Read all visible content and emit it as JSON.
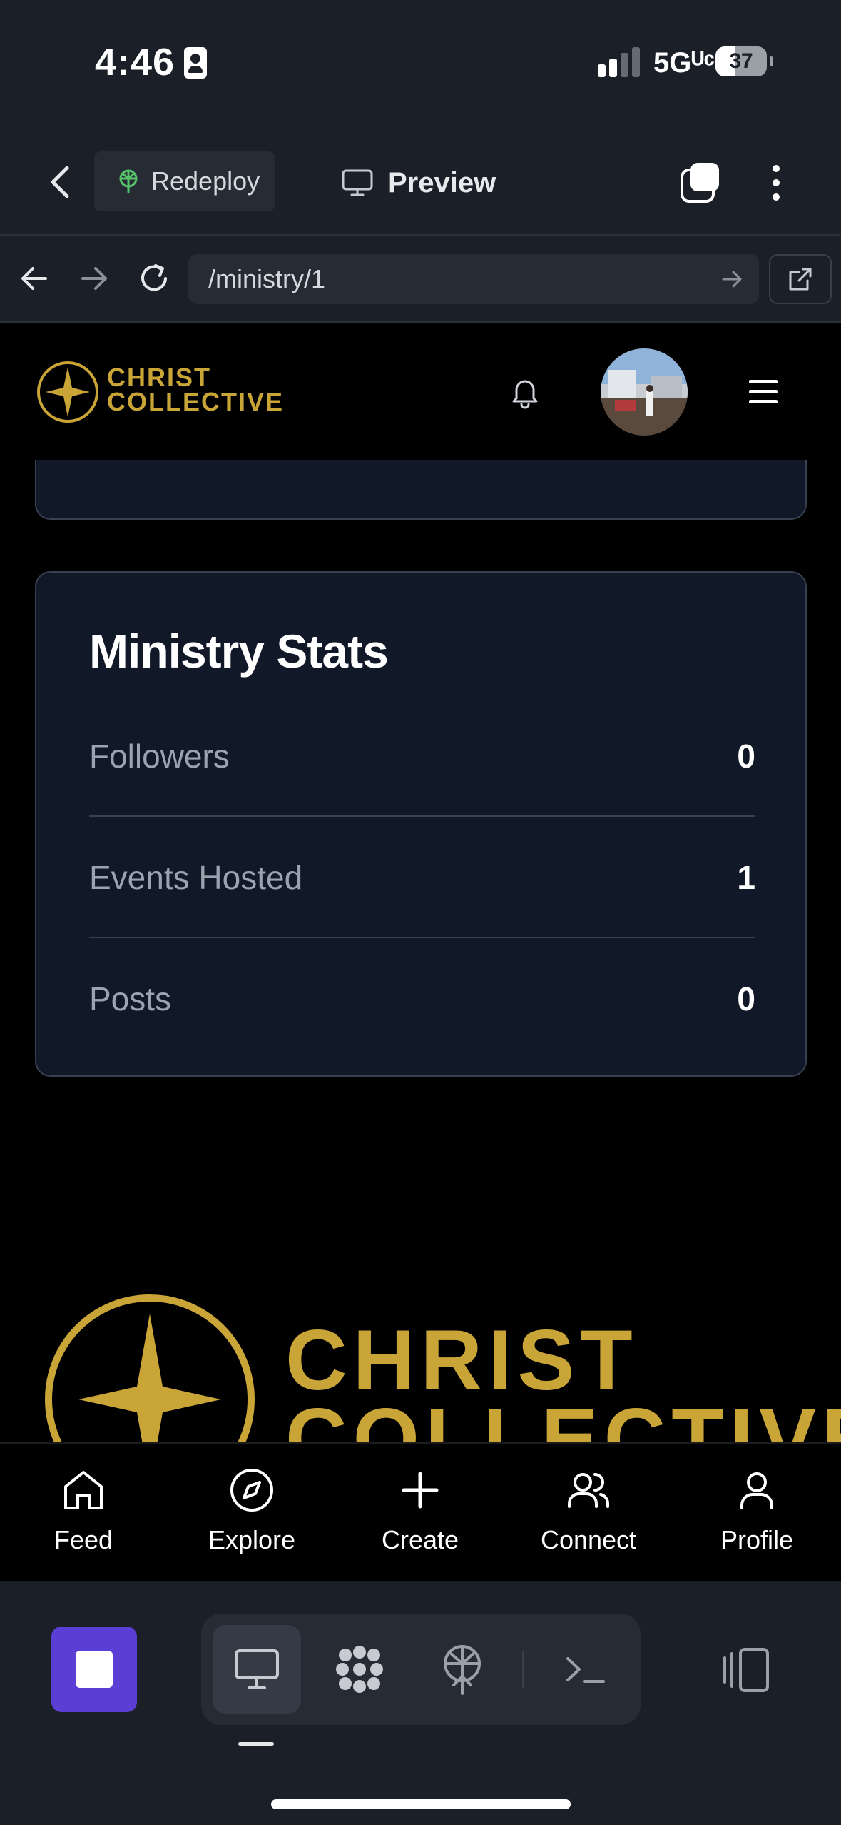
{
  "status_bar": {
    "time": "4:46",
    "network": "5Gᵁᶜ",
    "battery": "37",
    "battery_level": 0.37
  },
  "replit_topbar": {
    "redeploy_label": "Redeploy",
    "preview_label": "Preview"
  },
  "browser": {
    "url": "/ministry/1"
  },
  "site_header": {
    "logo_line1": "CHRIST",
    "logo_line2": "COLLECTIVE"
  },
  "ministry_stats": {
    "title": "Ministry Stats",
    "rows": [
      {
        "label": "Followers",
        "value": "0"
      },
      {
        "label": "Events Hosted",
        "value": "1"
      },
      {
        "label": "Posts",
        "value": "0"
      }
    ]
  },
  "footer": {
    "logo_line1": "CHRIST",
    "logo_line2": "COLLECTIVE"
  },
  "app_nav": {
    "items": [
      {
        "label": "Feed",
        "icon": "home-icon"
      },
      {
        "label": "Explore",
        "icon": "compass-icon"
      },
      {
        "label": "Create",
        "icon": "plus-icon"
      },
      {
        "label": "Connect",
        "icon": "users-icon"
      },
      {
        "label": "Profile",
        "icon": "user-icon"
      }
    ]
  },
  "replit_toolbar": {
    "tools": [
      "preview-monitor-icon",
      "agent-grid-icon",
      "deploy-icon",
      "console-icon"
    ],
    "layout_icon": "split-layout-icon",
    "stop_color": "#5b3fd4"
  },
  "colors": {
    "brand_gold": "#c9a437",
    "card_bg": "#111827",
    "card_border": "#374151"
  }
}
